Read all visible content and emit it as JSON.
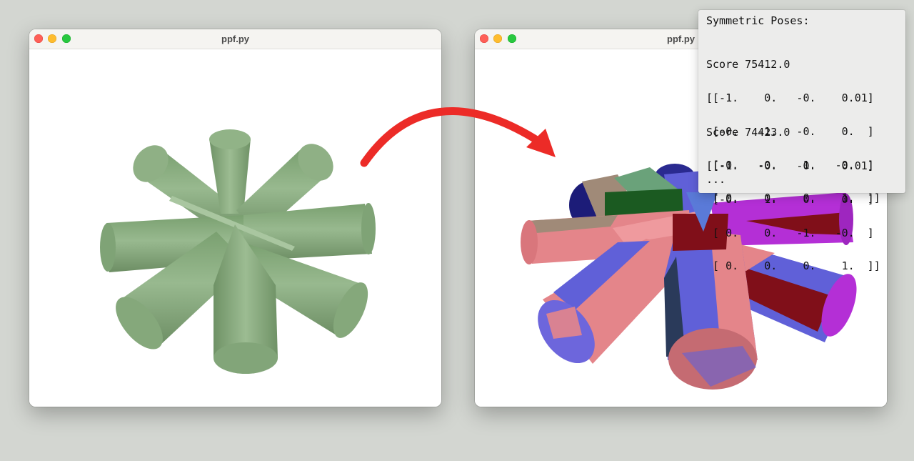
{
  "windows": {
    "left": {
      "title": "ppf.py"
    },
    "right": {
      "title": "ppf.py"
    }
  },
  "colors": {
    "desktop": "#d3d6d1",
    "model_green": "#86a97d",
    "arrow_red": "#ec2b27",
    "segment_pink": "#e4858a",
    "segment_blue": "#7068e0",
    "segment_magenta": "#b42fd6",
    "segment_darkred": "#800f19",
    "segment_navy": "#1c1c78",
    "segment_darkgreen": "#1b5a21"
  },
  "icons": [
    "close-light-icon",
    "minimize-light-icon",
    "maximize-light-icon",
    "curved-arrow-icon"
  ],
  "panel": {
    "header": "Symmetric Poses:",
    "poses": [
      {
        "score": "Score 75412.0",
        "matrix": [
          "[[-1.    0.   -0.    0.01]",
          " [-0.   -1.   -0.    0.  ]",
          " [-0.   -0.    1.   -0.  ]",
          " [ 0.    0.    0.    1.  ]]"
        ]
      },
      {
        "score": "Score 74423.0",
        "matrix": [
          "[[-1.   -0.   -0.    0.01]",
          " [-0.    1.    0.    0.  ]",
          " [ 0.    0.   -1.   -0.  ]",
          " [ 0.    0.    0.    1.  ]]"
        ]
      }
    ],
    "ellipsis": "..."
  }
}
